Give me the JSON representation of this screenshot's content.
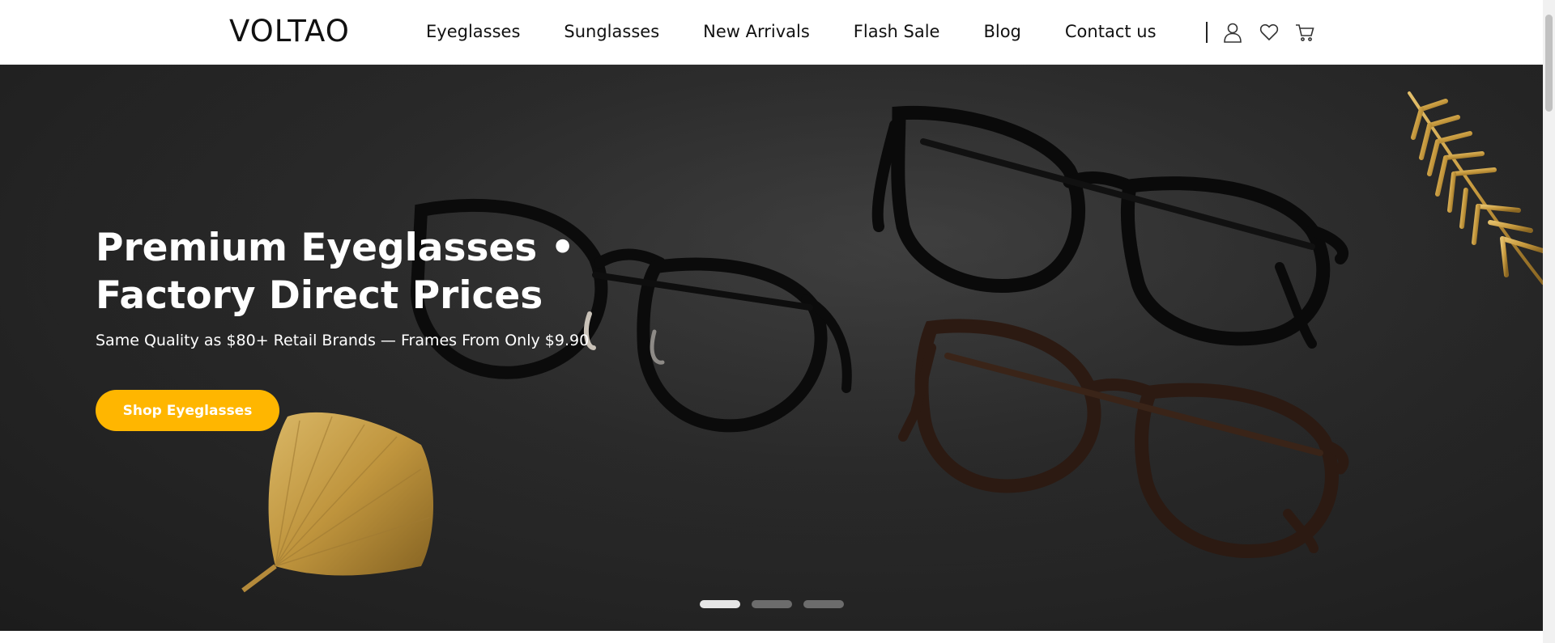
{
  "brand": {
    "logo": "VOLTAO"
  },
  "nav": {
    "items": [
      {
        "label": "Eyeglasses"
      },
      {
        "label": "Sunglasses"
      },
      {
        "label": "New Arrivals"
      },
      {
        "label": "Flash Sale"
      },
      {
        "label": "Blog"
      },
      {
        "label": "Contact us"
      }
    ]
  },
  "header_icons": [
    "user-icon",
    "heart-icon",
    "cart-icon"
  ],
  "hero": {
    "title_line1": "Premium Eyeglasses •",
    "title_line2": "Factory Direct Prices",
    "subtitle": "Same Quality as $80+ Retail Brands — Frames From Only $9.90",
    "cta_label": "Shop Eyeglasses",
    "slides_total": 3,
    "active_slide": 1
  },
  "colors": {
    "accent": "#ffb600",
    "hero_background": "#2a2a2a",
    "dot_active": "#e6e6e6",
    "dot_inactive": "#6c6c6c"
  }
}
